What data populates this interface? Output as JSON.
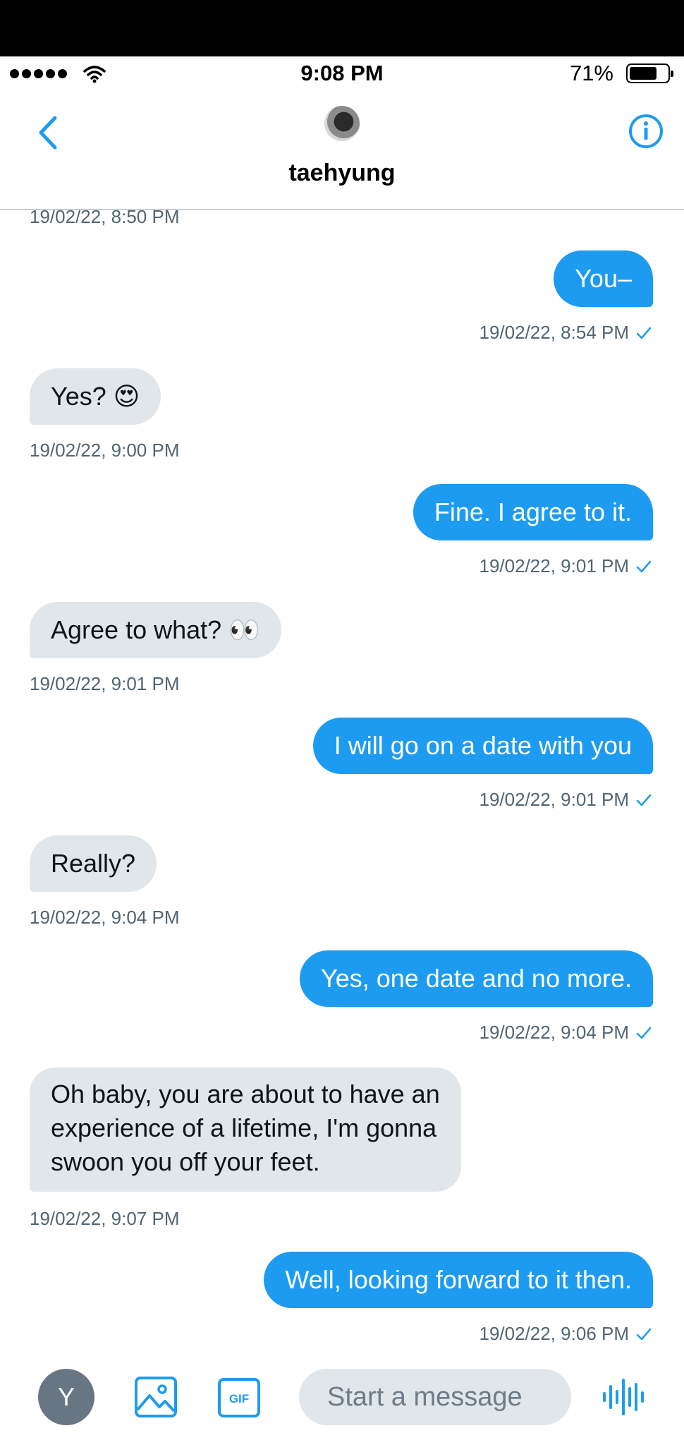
{
  "status_bar": {
    "time": "9:08 PM",
    "battery_percent": "71%",
    "battery_level": 0.71,
    "signal_dots": 5,
    "icons": [
      "signal-dots-icon",
      "wifi-icon",
      "battery-icon"
    ]
  },
  "header": {
    "contact_name": "taehyung",
    "icons": [
      "back-chevron-icon",
      "info-icon"
    ]
  },
  "conversation": {
    "partial_timestamp": "19/02/22, 8:50 PM",
    "messages": [
      {
        "direction": "out",
        "text": "You–",
        "timestamp": "19/02/22, 8:54 PM",
        "read": true
      },
      {
        "direction": "in",
        "text": "Yes? 😍",
        "timestamp": "19/02/22, 9:00 PM"
      },
      {
        "direction": "out",
        "text": "Fine. I agree to it.",
        "timestamp": "19/02/22, 9:01 PM",
        "read": true
      },
      {
        "direction": "in",
        "text": "Agree to what? 👀",
        "timestamp": "19/02/22, 9:01 PM"
      },
      {
        "direction": "out",
        "text": "I will go on a date with you",
        "timestamp": "19/02/22, 9:01 PM",
        "read": true
      },
      {
        "direction": "in",
        "text": "Really?",
        "timestamp": "19/02/22, 9:04 PM"
      },
      {
        "direction": "out",
        "text": "Yes, one date and no more.",
        "timestamp": "19/02/22, 9:04 PM",
        "read": true
      },
      {
        "direction": "in",
        "text": "Oh baby, you are about to have an\nexperience of a lifetime, I'm gonna\nswoon you off your feet.",
        "timestamp": "19/02/22, 9:07 PM"
      },
      {
        "direction": "out",
        "text": "Well, looking forward to it then.",
        "timestamp": "19/02/22, 9:06 PM",
        "read": true
      }
    ]
  },
  "composer": {
    "user_initial": "Y",
    "placeholder": "Start a message",
    "gif_label": "GIF",
    "icons": [
      "image-icon",
      "gif-icon",
      "voice-waveform-icon"
    ]
  },
  "colors": {
    "accent": "#1d9bf0",
    "incoming_bubble": "#e1e6ea",
    "timestamp": "#536471"
  }
}
